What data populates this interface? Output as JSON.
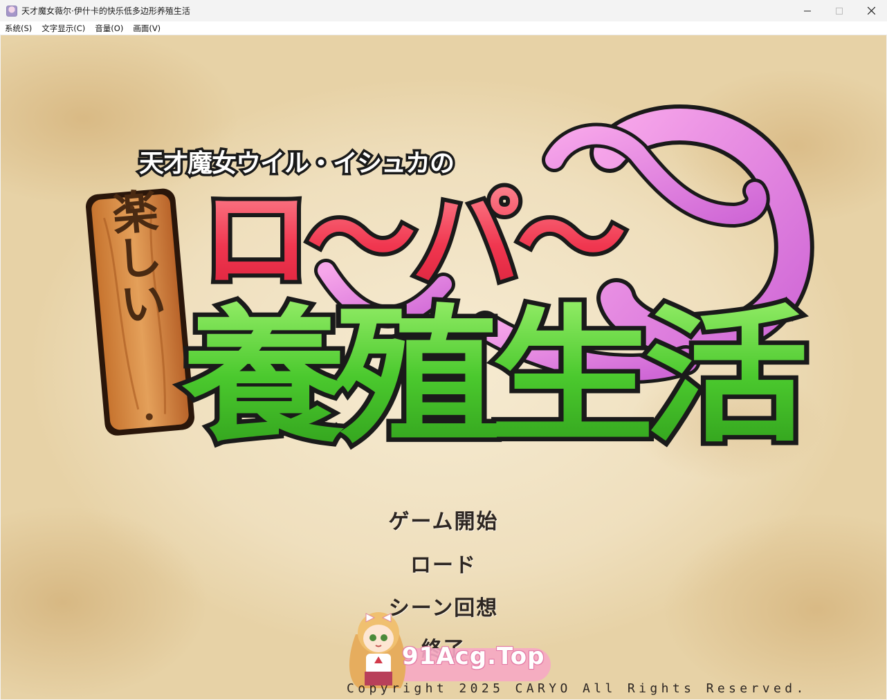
{
  "window": {
    "title": "天才魔女薇尔·伊什卡的快乐低多边形养殖生活",
    "icon": "app-icon"
  },
  "menubar": {
    "items": [
      "系统(S)",
      "文字显示(C)",
      "音量(O)",
      "画面(V)"
    ]
  },
  "logo": {
    "subtitle": "天才魔女ウイル・イシュカの",
    "plank_text": "楽しい",
    "red_text": "ロ〜パ〜",
    "green_text": "養殖生活"
  },
  "title_menu": {
    "start": "ゲーム開始",
    "load": "ロード",
    "scene": "シーン回想",
    "quit": "終了"
  },
  "copyright": "Copyright 2025 CARYO All Rights Reserved.",
  "watermark": {
    "text": "91Acg.Top"
  },
  "colors": {
    "parchment": "#efdfbd",
    "logo_red": "#f0364f",
    "logo_green": "#4bc92e",
    "tentacle": "#e38ee0",
    "menu_text": "#2d2622"
  }
}
